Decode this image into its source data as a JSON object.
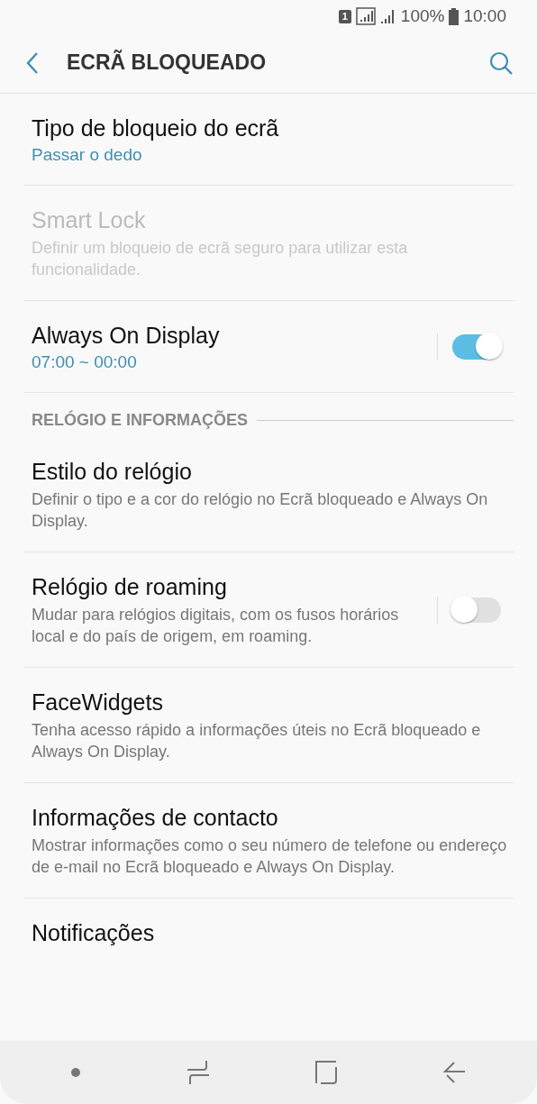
{
  "status_bar": {
    "sim": "1",
    "battery": "100%",
    "time": "10:00"
  },
  "header": {
    "title": "ECRÃ BLOQUEADO"
  },
  "items": [
    {
      "kind": "item",
      "title": "Tipo de bloqueio do ecrã",
      "value": "Passar o dedo",
      "disabled": false
    },
    {
      "kind": "item",
      "title": "Smart Lock",
      "summary": "Definir um bloqueio de ecrã seguro para utilizar esta funcionalidade.",
      "disabled": true
    },
    {
      "kind": "toggle",
      "title": "Always On Display",
      "value": "07:00 ~ 00:00",
      "on": true
    },
    {
      "kind": "section",
      "title": "RELÓGIO E INFORMAÇÕES"
    },
    {
      "kind": "item",
      "title": "Estilo do relógio",
      "summary": "Definir o tipo e a cor do relógio no Ecrã bloqueado e Always On Display.",
      "disabled": false
    },
    {
      "kind": "toggle",
      "title": "Relógio de roaming",
      "summary": "Mudar para relógios digitais, com os fusos horários local e do país de origem, em roaming.",
      "on": false
    },
    {
      "kind": "item",
      "title": "FaceWidgets",
      "summary": "Tenha acesso rápido a informações úteis no Ecrã bloqueado e Always On Display.",
      "disabled": false
    },
    {
      "kind": "item",
      "title": "Informações de contacto",
      "summary": "Mostrar informações como o seu número de telefone ou endereço de e-mail no Ecrã bloqueado e Always On Display.",
      "disabled": false
    },
    {
      "kind": "item",
      "title": "Notificações",
      "disabled": false
    }
  ]
}
